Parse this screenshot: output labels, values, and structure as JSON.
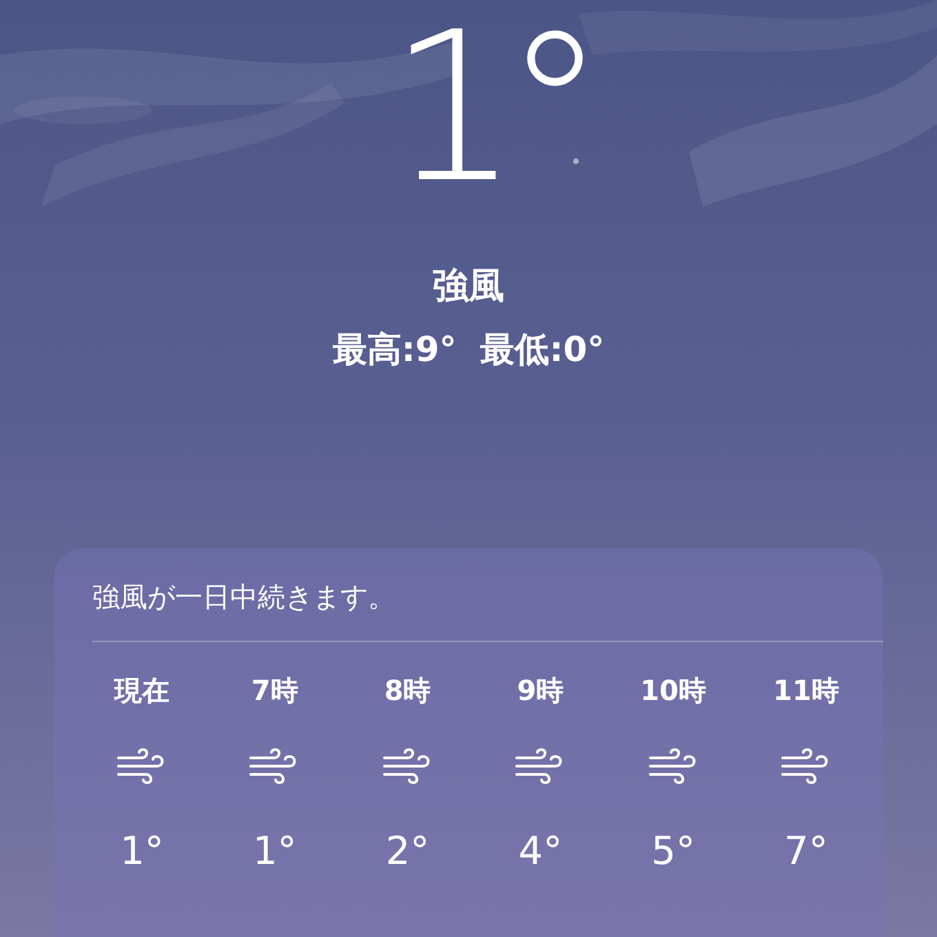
{
  "current": {
    "temperature": "1°",
    "condition": "強風",
    "high_low": "最高:9°  最低:0°"
  },
  "hourly_forecast": {
    "summary": "強風が一日中続きます。",
    "hours": [
      {
        "time": "現在",
        "kind": "wind",
        "temperature": "1°"
      },
      {
        "time": "7時",
        "kind": "wind",
        "temperature": "1°"
      },
      {
        "time": "8時",
        "kind": "wind",
        "temperature": "2°"
      },
      {
        "time": "9時",
        "kind": "wind",
        "temperature": "4°"
      },
      {
        "time": "10時",
        "kind": "wind",
        "temperature": "5°"
      },
      {
        "time": "11時",
        "kind": "wind",
        "temperature": "7°"
      }
    ]
  }
}
